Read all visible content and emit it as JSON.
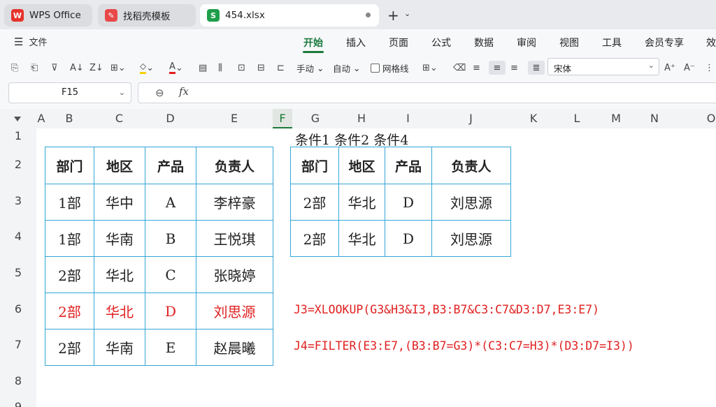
{
  "tabs": {
    "wps": "WPS Office",
    "daoke": "找稻壳模板",
    "file": "454.xlsx"
  },
  "ribbon": {
    "file_menu": "文件",
    "tabs": [
      "开始",
      "插入",
      "页面",
      "公式",
      "数据",
      "审阅",
      "视图",
      "工具",
      "会员专享",
      "效"
    ],
    "active_tab": "开始"
  },
  "toolbar": {
    "manual": "手动",
    "auto": "自动",
    "gridlines": "网格线",
    "font": "宋体"
  },
  "formula_bar": {
    "cell_ref": "F15",
    "formula": ""
  },
  "columns": [
    "A",
    "B",
    "C",
    "D",
    "E",
    "F",
    "G",
    "H",
    "I",
    "J",
    "K",
    "L",
    "M",
    "N",
    "O"
  ],
  "rows": [
    "1",
    "2",
    "3",
    "4",
    "5",
    "6",
    "7",
    "8",
    "9"
  ],
  "sheet": {
    "conditions_label": "条件1 条件2 条件4",
    "left_table": {
      "headers": [
        "部门",
        "地区",
        "产品",
        "负责人"
      ],
      "rows": [
        [
          "1部",
          "华中",
          "A",
          "李梓豪"
        ],
        [
          "1部",
          "华南",
          "B",
          "王悦琪"
        ],
        [
          "2部",
          "华北",
          "C",
          "张晓婷"
        ],
        [
          "2部",
          "华北",
          "D",
          "刘思源"
        ],
        [
          "2部",
          "华南",
          "E",
          "赵晨曦"
        ]
      ],
      "highlight_row_index": 3
    },
    "right_table": {
      "headers": [
        "部门",
        "地区",
        "产品",
        "负责人"
      ],
      "rows": [
        [
          "2部",
          "华北",
          "D",
          "刘思源"
        ],
        [
          "2部",
          "华北",
          "D",
          "刘思源"
        ]
      ]
    },
    "formula_note_1": "J3=XLOOKUP(G3&H3&I3,B3:B7&C3:C7&D3:D7,E3:E7)",
    "formula_note_2": "J4=FILTER(E3:E7,(B3:B7=G3)*(C3:C7=H3)*(D3:D7=I3))",
    "note_color": "#e02020",
    "border_color": "#35a6d6"
  },
  "colors": {
    "accent": "#1a7a3c",
    "wps_red": "#e5332a",
    "sheet_green": "#1e9e4a"
  }
}
